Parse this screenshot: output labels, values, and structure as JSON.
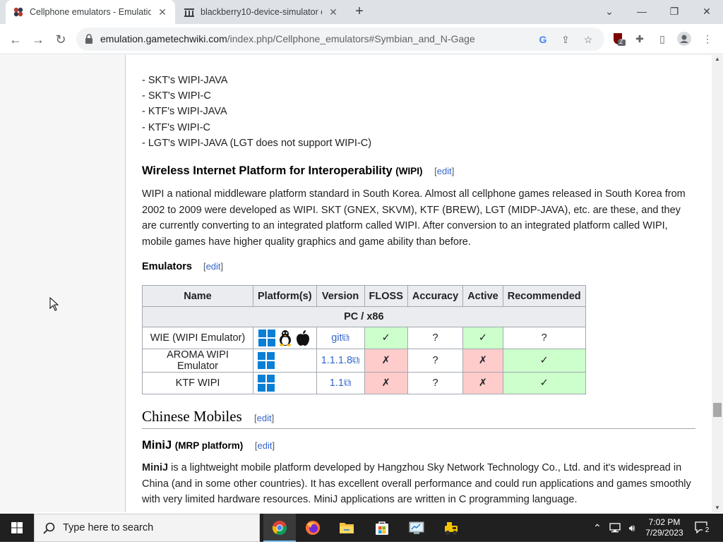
{
  "browser": {
    "tabs": [
      {
        "title": "Cellphone emulators - Emulation",
        "active": true
      },
      {
        "title": "blackberry10-device-simulator d",
        "active": false
      }
    ],
    "url_host": "emulation.gametechwiki.com",
    "url_path": "/index.php/Cellphone_emulators#Symbian_and_N-Gage",
    "extension_badge": "2"
  },
  "article": {
    "list_items": [
      "- SKT's WIPI-JAVA",
      "- SKT's WIPI-C",
      "- KTF's WIPI-JAVA",
      "- KTF's WIPI-C",
      "- LGT's WIPI-JAVA (LGT does not support WIPI-C)"
    ],
    "wipi_heading": "Wireless Internet Platform for Interoperability",
    "wipi_heading_small": "(WIPI)",
    "edit_label": "edit",
    "wipi_para": "WIPI a national middleware platform standard in South Korea. Almost all cellphone games released in South Korea from 2002 to 2009 were developed as WIPI. SKT (GNEX, SKVM), KTF (BREW), LGT (MIDP-JAVA), etc. are these, and they are currently converting to an integrated platform called WIPI. After conversion to an integrated platform called WIPI, mobile games have higher quality graphics and game ability than before.",
    "emulators_heading": "Emulators",
    "table": {
      "headers": [
        "Name",
        "Platform(s)",
        "Version",
        "FLOSS",
        "Accuracy",
        "Active",
        "Recommended"
      ],
      "section": "PC / x86",
      "rows": [
        {
          "name": "WIE (WIPI Emulator)",
          "platforms": [
            "windows-icon",
            "linux-icon",
            "apple-icon"
          ],
          "version": "git",
          "floss": "✓",
          "floss_state": "yes",
          "accuracy": "?",
          "active": "✓",
          "active_state": "yes",
          "recommended": "?",
          "recommended_state": "none"
        },
        {
          "name": "AROMA WIPI Emulator",
          "platforms": [
            "windows-icon"
          ],
          "version": "1.1.1.8",
          "floss": "✗",
          "floss_state": "no",
          "accuracy": "?",
          "active": "✗",
          "active_state": "no",
          "recommended": "✓",
          "recommended_state": "yes"
        },
        {
          "name": "KTF WIPI",
          "platforms": [
            "windows-icon"
          ],
          "version": "1.1",
          "floss": "✗",
          "floss_state": "no",
          "accuracy": "?",
          "active": "✗",
          "active_state": "no",
          "recommended": "✓",
          "recommended_state": "yes"
        }
      ]
    },
    "chinese_heading": "Chinese Mobiles",
    "minij_heading": "MiniJ",
    "minij_heading_small": "(MRP platform)",
    "minij_bold": "MiniJ",
    "minij_para": " is a lightweight mobile platform developed by Hangzhou Sky Network Technology Co., Ltd. and it's widespread in China (and in some other countries). It has excellent overall performance and could run applications and games smoothly with very limited hardware resources. MiniJ applications are written in C programming language."
  },
  "taskbar": {
    "search_placeholder": "Type here to search",
    "time": "7:02 PM",
    "date": "7/29/2023",
    "notification_count": "2"
  },
  "colors": {
    "link": "#3366cc",
    "yes": "#ccffcc",
    "no": "#ffcccc",
    "header": "#eaecf0"
  }
}
